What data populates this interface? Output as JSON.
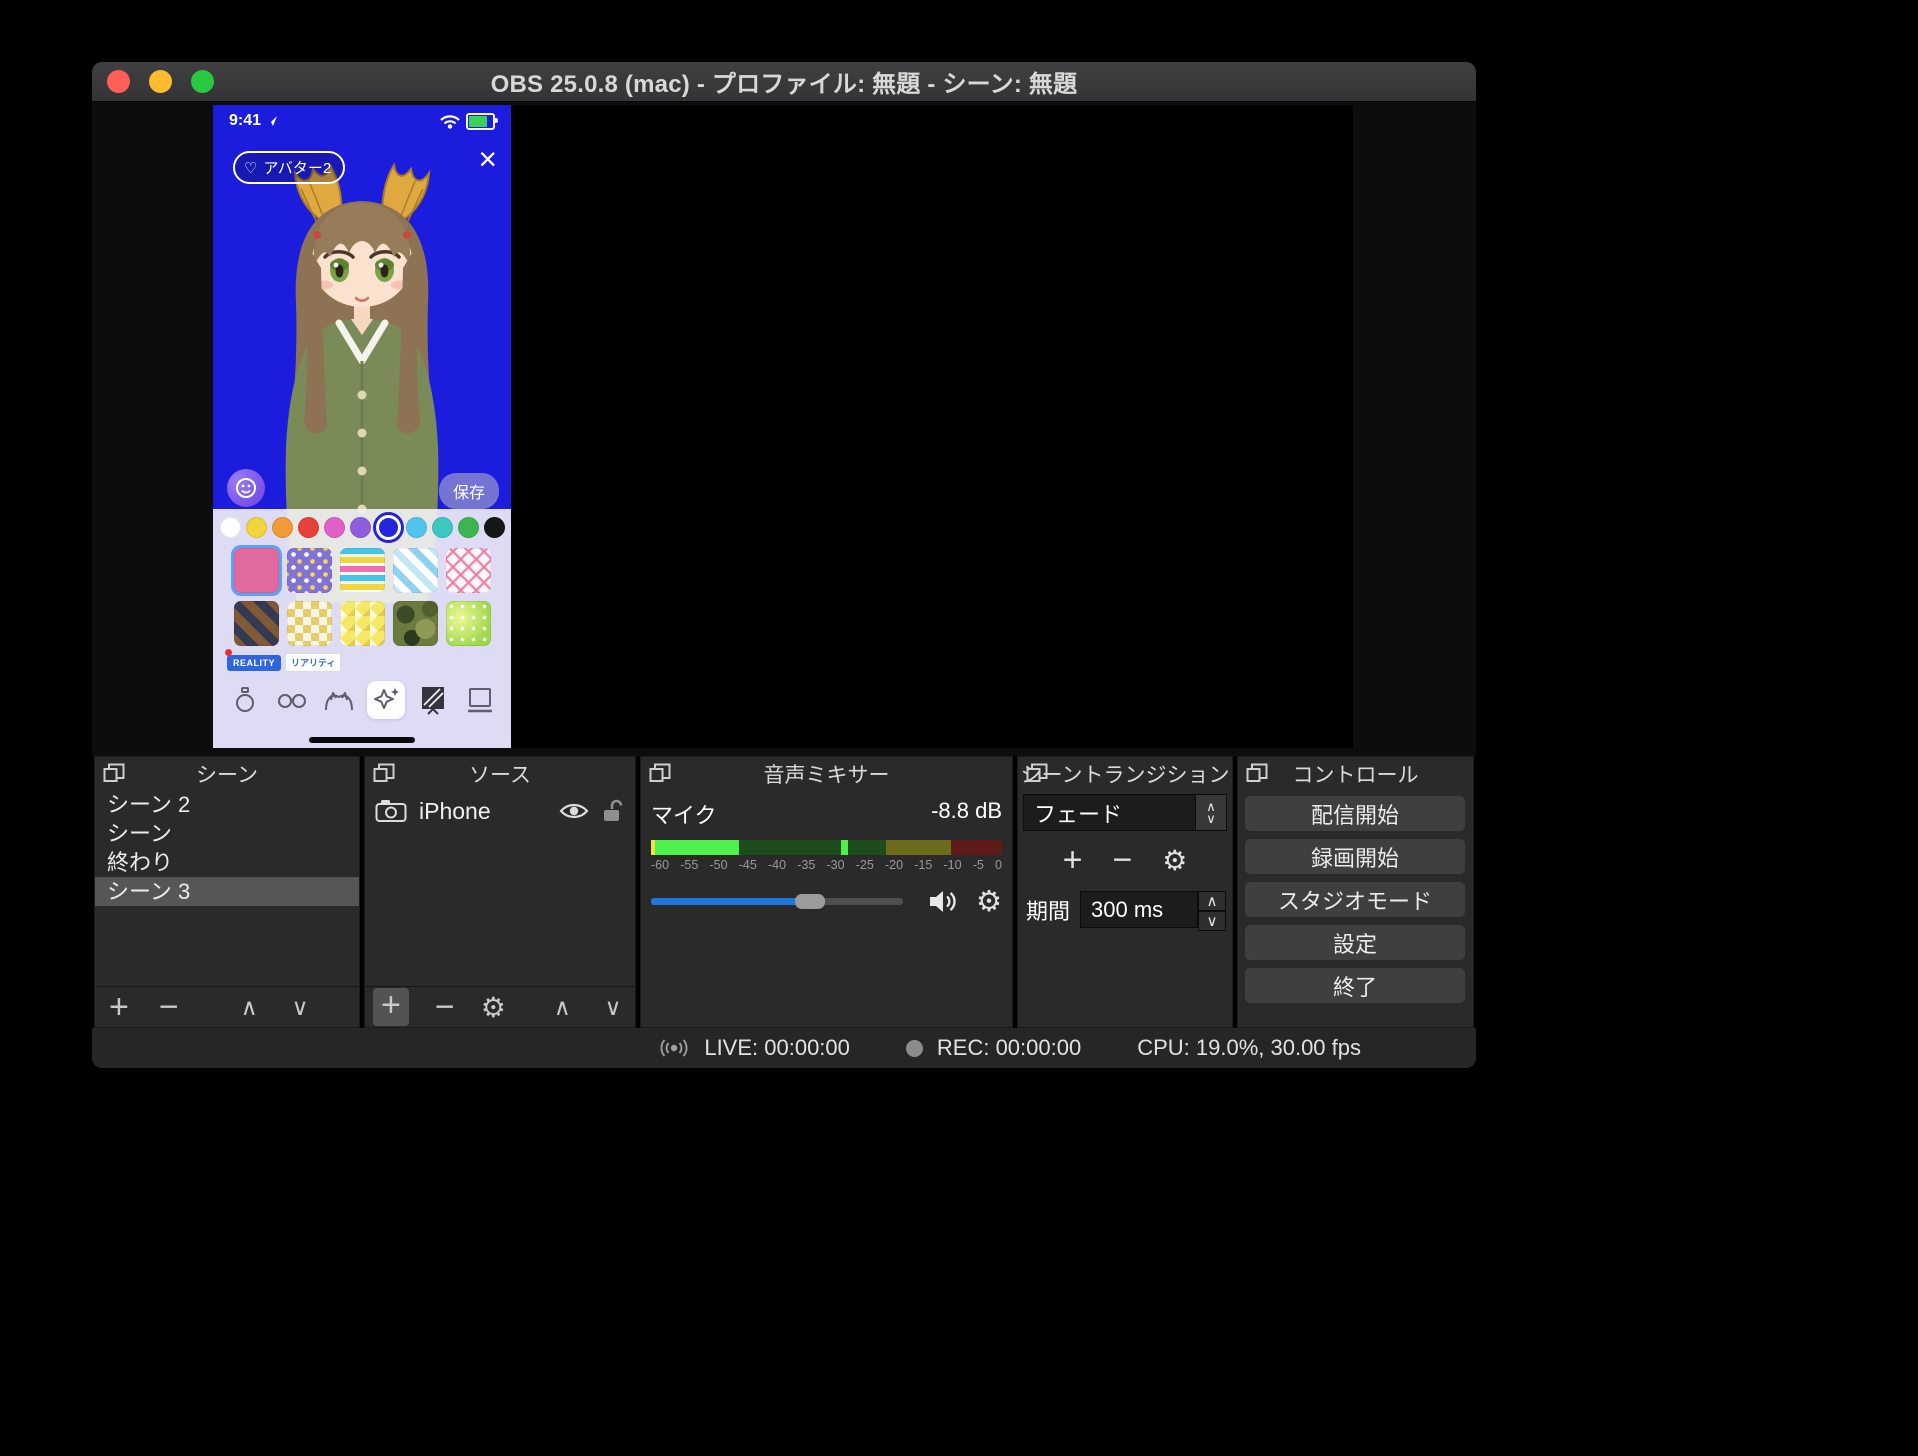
{
  "window": {
    "title": "OBS 25.0.8 (mac) - プロファイル: 無題 - シーン: 無題"
  },
  "phone": {
    "status_time": "9:41",
    "avatar_badge": "アバター2",
    "avatar_badge_icon": "♡",
    "close_glyph": "×",
    "save_button": "保存",
    "color_swatches": [
      "#ffffff",
      "#f2d43c",
      "#f09a38",
      "#e8403a",
      "#e060c8",
      "#8f5ede",
      "#2525dd",
      "#52c4ee",
      "#3cc8c0",
      "#3cb450",
      "#161616"
    ],
    "selected_color_index": 6,
    "patterns": [
      "solid-pink",
      "purple-dots",
      "zigzag",
      "diagonal-stripes",
      "pink-lattice",
      "brown-argyle",
      "checkerboard",
      "triangle-mosaic",
      "camouflage",
      "green-glitter"
    ],
    "selected_pattern_index": 0,
    "badges": [
      "REALITY",
      "リアリティ"
    ]
  },
  "docks": {
    "scenes": {
      "title": "シーン",
      "items": [
        "シーン 2",
        "シーン",
        "終わり",
        "シーン 3"
      ],
      "selected_index": 3,
      "tools": {
        "add": "+",
        "remove": "−",
        "up": "∧",
        "down": "∨"
      }
    },
    "sources": {
      "title": "ソース",
      "items": [
        {
          "label": "iPhone"
        }
      ],
      "tools": {
        "add": "+",
        "remove": "−",
        "gear": "⚙",
        "up": "∧",
        "down": "∨"
      }
    },
    "mixer": {
      "title": "音声ミキサー",
      "channel": "マイク",
      "level": "-8.8 dB",
      "ticks": [
        "-60",
        "-55",
        "-50",
        "-45",
        "-40",
        "-35",
        "-30",
        "-25",
        "-20",
        "-15",
        "-10",
        "-5",
        "0"
      ],
      "volume_percent": 63,
      "gear": "⚙"
    },
    "transitions": {
      "title": "シーントランジション",
      "selected_transition": "フェード",
      "tools": {
        "add": "+",
        "remove": "−",
        "gear": "⚙"
      },
      "duration_label": "期間",
      "duration_value": "300 ms",
      "arrow_up": "∧",
      "arrow_down": "∨"
    },
    "controls": {
      "title": "コントロール",
      "buttons": [
        "配信開始",
        "録画開始",
        "スタジオモード",
        "設定",
        "終了"
      ]
    }
  },
  "statusbar": {
    "live": "LIVE: 00:00:00",
    "rec": "REC: 00:00:00",
    "cpu": "CPU: 19.0%, 30.00 fps"
  }
}
